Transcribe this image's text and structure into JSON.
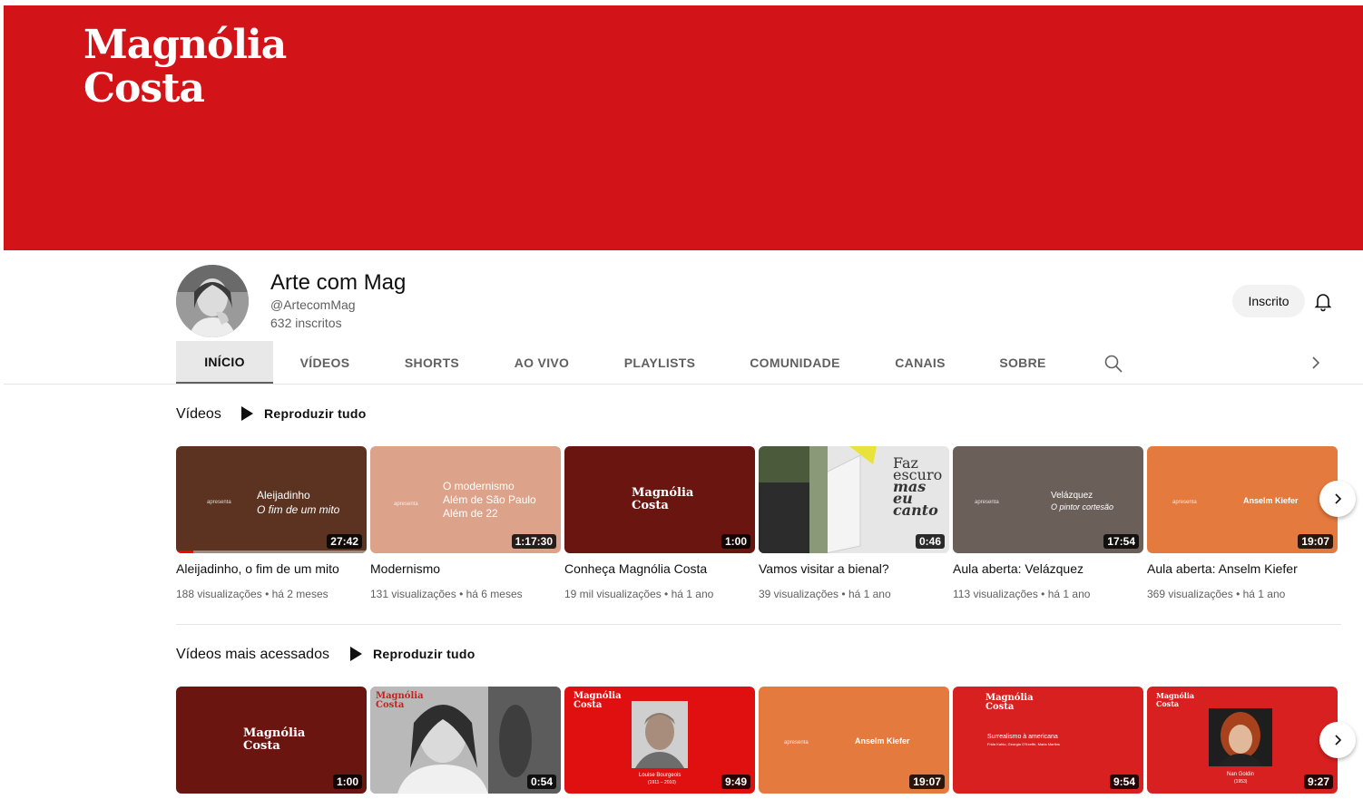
{
  "banner": {
    "logo_line1": "Magnólia",
    "logo_line2": "Costa",
    "color": "#d21317"
  },
  "channel": {
    "name": "Arte com Mag",
    "handle": "@ArtecomMag",
    "subscribers": "632 inscritos",
    "subscribe_label": "Inscrito"
  },
  "tabs": [
    "INÍCIO",
    "VÍDEOS",
    "SHORTS",
    "AO VIVO",
    "PLAYLISTS",
    "COMUNIDADE",
    "CANAIS",
    "SOBRE"
  ],
  "shelf1": {
    "title": "Vídeos",
    "play_all": "Reproduzir tudo",
    "videos": [
      {
        "title": "Aleijadinho, o fim de um mito",
        "views": "188 visualizações",
        "age": "há 2 meses",
        "duration": "27:42",
        "progress": 0.09,
        "bg": "#5b3320",
        "thumb_small": "apresenta",
        "thumb_line1": "Aleijadinho",
        "thumb_line2": "O fim de um mito"
      },
      {
        "title": "Modernismo",
        "views": "131 visualizações",
        "age": "há 6 meses",
        "duration": "1:17:30",
        "bg": "#dca38a",
        "thumb_small": "apresenta",
        "thumb_line1": "O modernismo",
        "thumb_line2": "Além de São Paulo",
        "thumb_line3": "Além de 22"
      },
      {
        "title": "Conheça Magnólia Costa",
        "views": "19 mil visualizações",
        "age": "há 1 ano",
        "duration": "1:00",
        "bg": "#6b1510",
        "thumb_logo1": "Magnólia",
        "thumb_logo2": "Costa"
      },
      {
        "title": "Vamos visitar a bienal?",
        "views": "39 visualizações",
        "age": "há 1 ano",
        "duration": "0:46",
        "bg": "#e4e4e4",
        "thumb_text1": "Faz",
        "thumb_text2": "escuro",
        "thumb_text3": "mas",
        "thumb_text4": "eu",
        "thumb_text5": "canto"
      },
      {
        "title": "Aula aberta: Velázquez",
        "views": "113 visualizações",
        "age": "há 1 ano",
        "duration": "17:54",
        "bg": "#6b5f5a",
        "thumb_small": "apresenta",
        "thumb_line1": "Velázquez",
        "thumb_line2": "O pintor cortesão"
      },
      {
        "title": "Aula aberta: Anselm Kiefer",
        "views": "369 visualizações",
        "age": "há 1 ano",
        "duration": "19:07",
        "bg": "#e57a3e",
        "thumb_small": "apresenta",
        "thumb_line1": "Anselm Kiefer"
      }
    ]
  },
  "shelf2": {
    "title": "Vídeos mais acessados",
    "play_all": "Reproduzir tudo",
    "videos": [
      {
        "duration": "1:00",
        "bg": "#6b1510",
        "thumb_logo1": "Magnólia",
        "thumb_logo2": "Costa"
      },
      {
        "duration": "0:54",
        "bg": "#8a8a8a",
        "thumb_logo1": "Magnólia",
        "thumb_logo2": "Costa"
      },
      {
        "duration": "9:49",
        "bg": "#e01010",
        "thumb_logo1": "Magnólia",
        "thumb_logo2": "Costa",
        "thumb_caption1": "Louise Bourgeois",
        "thumb_caption2": "(1911 – 2010)"
      },
      {
        "duration": "19:07",
        "bg": "#e57a3e",
        "thumb_small": "apresenta",
        "thumb_line1": "Anselm Kiefer"
      },
      {
        "duration": "9:54",
        "bg": "#d92020",
        "thumb_logo1": "Magnólia",
        "thumb_logo2": "Costa",
        "thumb_caption1": "Surrealismo à americana",
        "thumb_caption2": "Frida Kahlo, Georgia O'Keeffe, Maria Martins"
      },
      {
        "duration": "9:27",
        "bg": "#d92020",
        "thumb_logo1": "Magnólia",
        "thumb_logo2": "Costa",
        "thumb_caption1": "Nan Goldin",
        "thumb_caption2": "(1953)"
      }
    ]
  }
}
